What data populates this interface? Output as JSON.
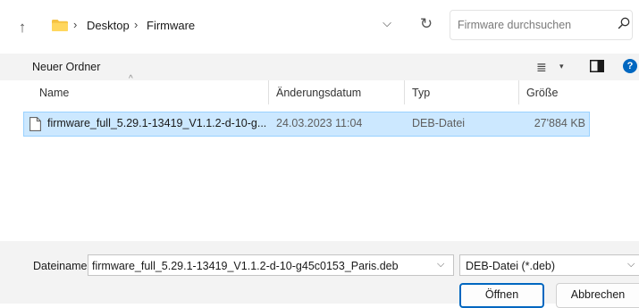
{
  "address_bar": {
    "breadcrumb": [
      "Desktop",
      "Firmware"
    ],
    "separator": "›"
  },
  "search": {
    "placeholder": "Firmware durchsuchen"
  },
  "toolbar": {
    "new_folder_label": "Neuer Ordner"
  },
  "columns": [
    "Name",
    "Änderungsdatum",
    "Typ",
    "Größe"
  ],
  "files": [
    {
      "name": "firmware_full_5.29.1-13419_V1.1.2-d-10-g...",
      "modified": "24.03.2023 11:04",
      "type": "DEB-Datei",
      "size": "27'884 KB",
      "selected": true
    }
  ],
  "bottom": {
    "filename_label": "Dateiname:",
    "filename_value": "firmware_full_5.29.1-13419_V1.1.2-d-10-g45c0153_Paris.deb",
    "filetype_value": "DEB-Datei (*.deb)",
    "open_label": "Öffnen",
    "cancel_label": "Abbrechen"
  },
  "icons": {
    "up": "arrow-up-icon",
    "folder": "folder-icon",
    "refresh": "refresh-icon",
    "search": "search-icon",
    "view": "view-list-icon",
    "pane": "preview-pane-icon",
    "help": "help-icon",
    "document": "document-icon"
  },
  "colors": {
    "accent": "#0067c0",
    "selection_bg": "#cce8ff",
    "folder": "#f5c242"
  }
}
